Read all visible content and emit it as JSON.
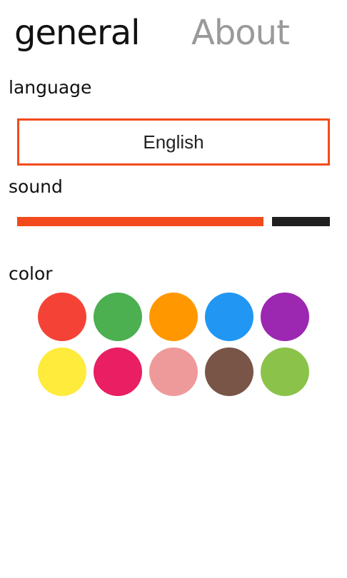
{
  "pivot": {
    "tabs": [
      {
        "label": "general",
        "active": true
      },
      {
        "label": "About",
        "active": false
      }
    ]
  },
  "language": {
    "label": "language",
    "selected": "English"
  },
  "sound": {
    "label": "sound",
    "level_fraction": 0.81
  },
  "color": {
    "label": "color",
    "swatches": [
      "#f44336",
      "#4caf50",
      "#ff9800",
      "#2196f3",
      "#9c27b0",
      "#ffeb3b",
      "#e91e63",
      "#ef9a9a",
      "#795548",
      "#8bc34a"
    ]
  },
  "colors": {
    "accent": "#f24a1c",
    "slider_track": "#1f1f1f",
    "inactive_tab": "#9a9a9a"
  }
}
